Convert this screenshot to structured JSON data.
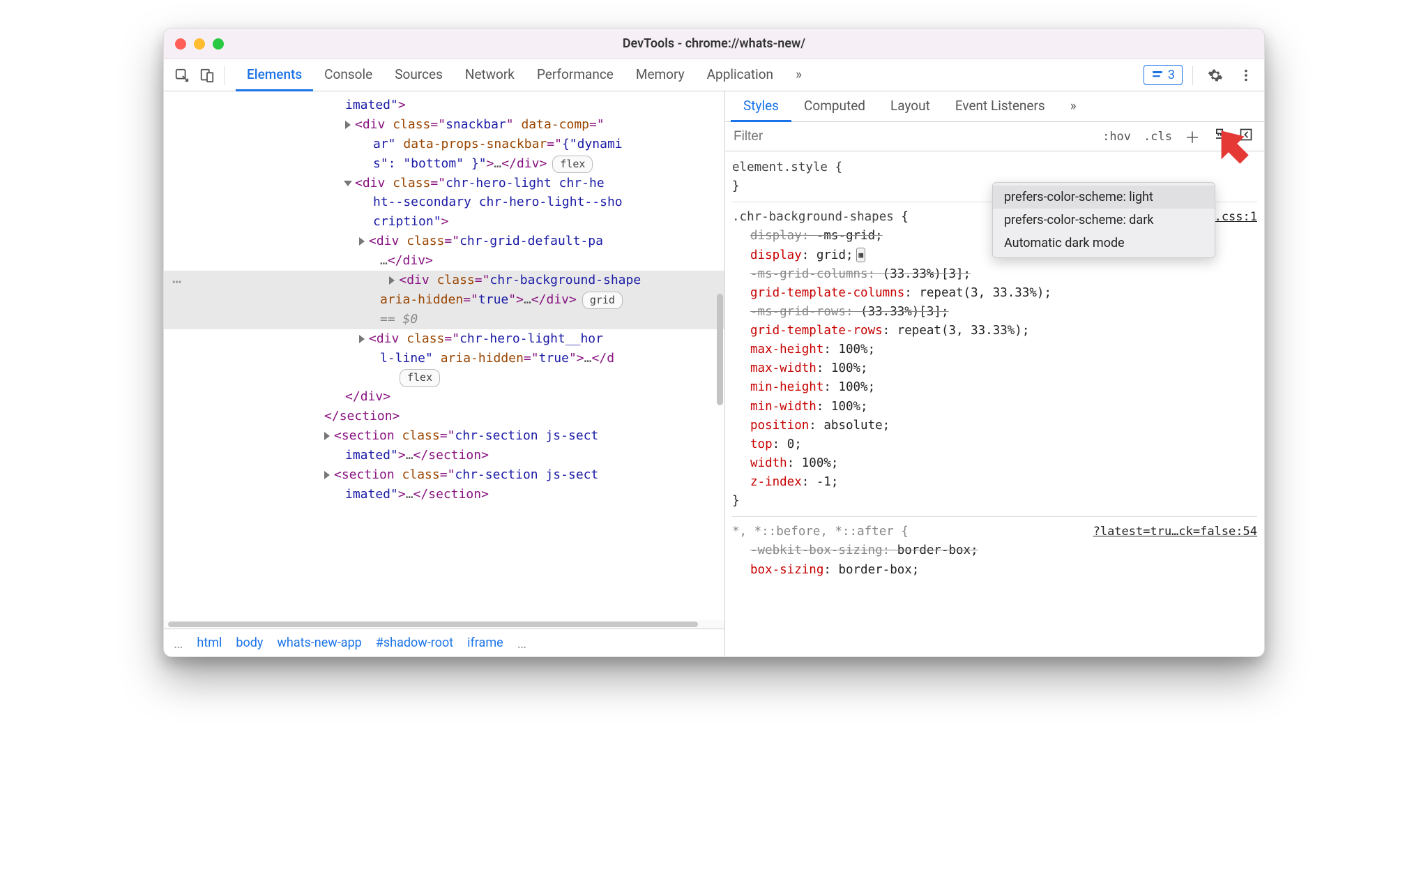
{
  "window": {
    "title": "DevTools - chrome://whats-new/"
  },
  "main_tabs": [
    "Elements",
    "Console",
    "Sources",
    "Network",
    "Performance",
    "Memory",
    "Application"
  ],
  "main_tabs_active": 0,
  "issues_count": "3",
  "dom": {
    "pills": {
      "flex": "flex",
      "grid": "grid"
    },
    "lines": {
      "l0a": "imated\"",
      "l1": "div",
      "l1_attr1": "class",
      "l1_val1": "snackbar",
      "l1_attr2": "data-comp",
      "l2a": "ar\"",
      "l2_attr": "data-props-snackbar",
      "l2_val": "{\"dynami",
      "l3a": "s\": \"bottom\" }\"",
      "l3_ell": "…",
      "l4": "div",
      "l4_attr": "class",
      "l4_val": "chr-hero-light chr-he",
      "l5": "ht--secondary chr-hero-light--sho",
      "l6": "cription\"",
      "l7": "div",
      "l7_attr": "class",
      "l7_val": "chr-grid-default-pa",
      "l8_ell": "…",
      "l9": "div",
      "l9_attr": "class",
      "l9_val": "chr-background-shape",
      "l10_attr": "aria-hidden",
      "l10_val": "true",
      "l10_ell": "…",
      "l11": "== $0",
      "l12": "div",
      "l12_attr": "class",
      "l12_val": "chr-hero-light__hor",
      "l13a": "l-line\"",
      "l13_attr": "aria-hidden",
      "l13_val": "true",
      "l13_ell": "…",
      "l14_close": "div",
      "l15_close": "section",
      "l16": "section",
      "l16_attr": "class",
      "l16_val": "chr-section js-sect",
      "l17a": "imated\"",
      "l17_ell": "…",
      "l18": "section",
      "l18_attr": "class",
      "l18_val": "chr-section js-sect",
      "l19a": "imated\"",
      "l19_ell": "…"
    }
  },
  "breadcrumb": [
    "html",
    "body",
    "whats-new-app",
    "#shadow-root",
    "iframe"
  ],
  "sub_tabs": [
    "Styles",
    "Computed",
    "Layout",
    "Event Listeners"
  ],
  "sub_tabs_active": 0,
  "styles_toolbar": {
    "filter_placeholder": "Filter",
    "hov": ":hov",
    "cls": ".cls"
  },
  "popup": {
    "items": [
      "prefers-color-scheme: light",
      "prefers-color-scheme: dark",
      "Automatic dark mode"
    ]
  },
  "styles": {
    "element_style": "element.style {",
    "close": "}",
    "rule2": {
      "selector": ".chr-background-shapes",
      "source": "n.css:1",
      "props": [
        {
          "strike": true,
          "name": "display",
          "sep": ":  ",
          "val": "-ms-grid;"
        },
        {
          "strike": false,
          "name": "display",
          "sep": ": ",
          "val": "grid;",
          "grid_icon": true
        },
        {
          "strike": true,
          "name": "-ms-grid-columns",
          "sep": ": ",
          "val": "(33.33%)[3];"
        },
        {
          "strike": false,
          "name": "grid-template-columns",
          "sep": ": ",
          "val": "repeat(3, 33.33%);"
        },
        {
          "strike": true,
          "name": "-ms-grid-rows",
          "sep": ": ",
          "val": "(33.33%)[3];"
        },
        {
          "strike": false,
          "name": "grid-template-rows",
          "sep": ": ",
          "val": "repeat(3, 33.33%);"
        },
        {
          "strike": false,
          "name": "max-height",
          "sep": ": ",
          "val": "100%;"
        },
        {
          "strike": false,
          "name": "max-width",
          "sep": ": ",
          "val": "100%;"
        },
        {
          "strike": false,
          "name": "min-height",
          "sep": ": ",
          "val": "100%;"
        },
        {
          "strike": false,
          "name": "min-width",
          "sep": ": ",
          "val": "100%;"
        },
        {
          "strike": false,
          "name": "position",
          "sep": ": ",
          "val": "absolute;"
        },
        {
          "strike": false,
          "name": "top",
          "sep": ": ",
          "val": "0;"
        },
        {
          "strike": false,
          "name": "width",
          "sep": ": ",
          "val": "100%;"
        },
        {
          "strike": false,
          "name": "z-index",
          "sep": ": ",
          "val": "-1;"
        }
      ]
    },
    "rule3": {
      "selector": "*, *::before, *::after {",
      "source": "?latest=tru…ck=false:54",
      "props": [
        {
          "strike": true,
          "name": "-webkit-box-sizing",
          "sep": ": ",
          "val": "border-box;"
        },
        {
          "strike": false,
          "name": "box-sizing",
          "sep": ": ",
          "val": "border-box;"
        }
      ]
    }
  }
}
